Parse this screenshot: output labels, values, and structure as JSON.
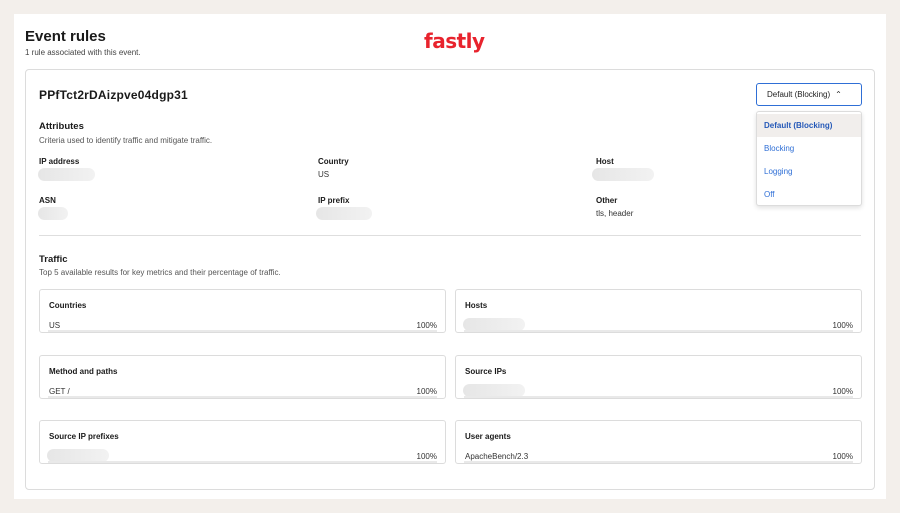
{
  "header": {
    "title": "Event rules",
    "subtitle": "1 rule associated with this event.",
    "logo_text": "fastly"
  },
  "rule": {
    "id": "PPfTct2rDAizpve04dgp31",
    "select": {
      "value": "Default (Blocking)",
      "options": [
        "Default (Blocking)",
        "Blocking",
        "Logging",
        "Off"
      ]
    }
  },
  "attributes": {
    "title": "Attributes",
    "subtitle": "Criteria used to identify traffic and mitigate traffic.",
    "ip_address": {
      "label": "IP address",
      "value": ""
    },
    "country": {
      "label": "Country",
      "value": "US"
    },
    "host": {
      "label": "Host",
      "value": ""
    },
    "asn": {
      "label": "ASN",
      "value": ""
    },
    "ip_prefix": {
      "label": "IP prefix",
      "value": ""
    },
    "other": {
      "label": "Other",
      "value": "tls, header"
    }
  },
  "traffic": {
    "title": "Traffic",
    "subtitle": "Top 5 available results for key metrics and their percentage of traffic.",
    "cards": [
      {
        "title": "Countries",
        "value": "US",
        "percent": "100%",
        "fraction": 1.0
      },
      {
        "title": "Hosts",
        "value": "",
        "percent": "100%",
        "fraction": 1.0
      },
      {
        "title": "Method and paths",
        "value": "GET /",
        "percent": "100%",
        "fraction": 1.0
      },
      {
        "title": "Source IPs",
        "value": "",
        "percent": "100%",
        "fraction": 1.0
      },
      {
        "title": "Source IP prefixes",
        "value": "",
        "percent": "100%",
        "fraction": 1.0
      },
      {
        "title": "User agents",
        "value": "ApacheBench/2.3",
        "percent": "100%",
        "fraction": 1.0
      }
    ]
  },
  "colors": {
    "accent": "#2f6fd6",
    "brand": "#e8232d",
    "background": "#f3efeb"
  }
}
